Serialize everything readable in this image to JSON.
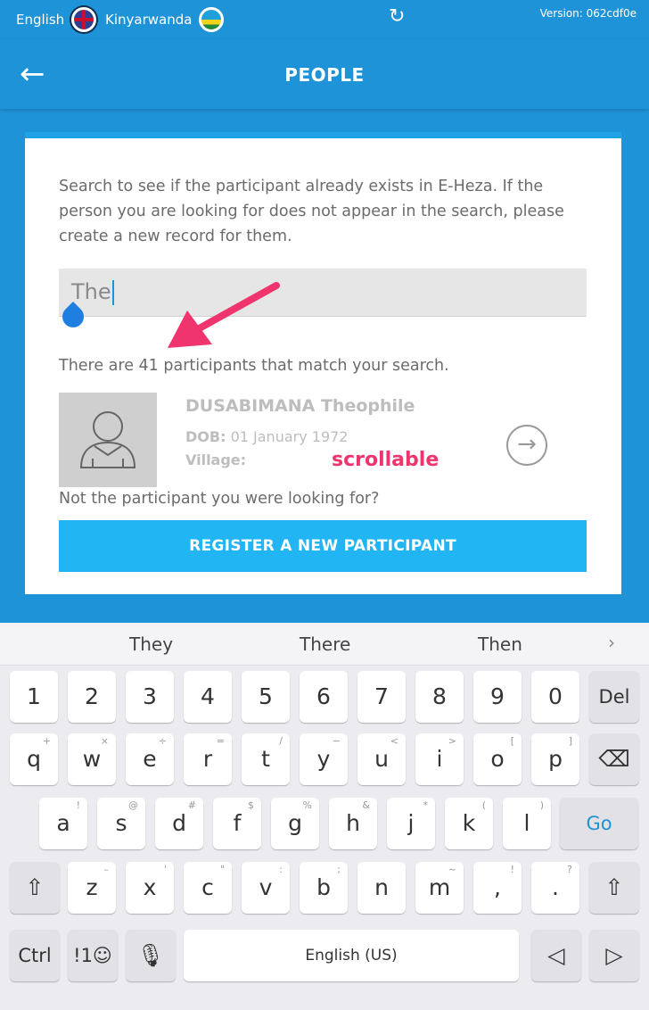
{
  "status": {
    "lang_en": "English",
    "lang_rw": "Kinyarwanda",
    "version": "Version: 062cdf0e"
  },
  "header": {
    "title": "PEOPLE"
  },
  "content": {
    "instructions": "Search to see if the participant already exists in E-Heza. If the person you are looking for does not appear in the search, please create a new record for them.",
    "search_value": "The",
    "count_text": "There are 41 participants that match your search.",
    "participant": {
      "name": "DUSABIMANA Theophile",
      "dob_label": "DOB:",
      "dob_value": "01 January 1972",
      "village_label": "Village:"
    },
    "scroll_annotation": "scrollable",
    "not_found_text": "Not the participant you were looking for?",
    "register_label": "REGISTER A NEW PARTICIPANT"
  },
  "keyboard": {
    "suggestions": [
      "They",
      "There",
      "Then"
    ],
    "row1": [
      "1",
      "2",
      "3",
      "4",
      "5",
      "6",
      "7",
      "8",
      "9",
      "0",
      "Del"
    ],
    "row2": [
      "q",
      "w",
      "e",
      "r",
      "t",
      "y",
      "u",
      "i",
      "o",
      "p"
    ],
    "row2_hints": [
      "+",
      "×",
      "÷",
      "=",
      "/",
      "−",
      "<",
      ">",
      "[",
      "]"
    ],
    "row3": [
      "a",
      "s",
      "d",
      "f",
      "g",
      "h",
      "j",
      "k",
      "l",
      "Go"
    ],
    "row3_hints": [
      "!",
      "@",
      "#",
      "$",
      "%",
      "&",
      "*",
      "(",
      ")"
    ],
    "row4": [
      "z",
      "x",
      "c",
      "v",
      "b",
      "n",
      "m",
      ",",
      "."
    ],
    "row4_hints": [
      "–",
      "'",
      "\"",
      ":",
      ";",
      "",
      "~",
      "!",
      "?"
    ],
    "ctrl": "Ctrl",
    "sym": "!1☺",
    "space": "English (US)"
  },
  "colors": {
    "brand_blue": "#1f93d8",
    "register_blue": "#22b5f4",
    "annotation_pink": "#f0346e"
  }
}
